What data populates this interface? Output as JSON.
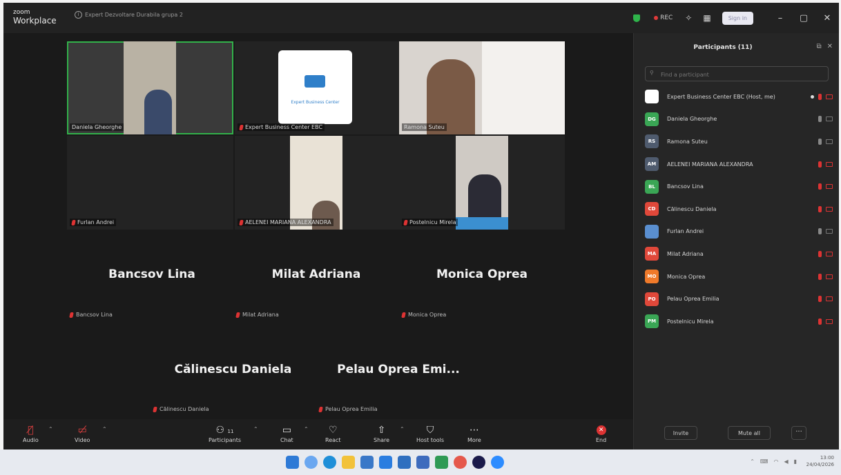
{
  "app": {
    "logo_top": "zoom",
    "logo_bottom": "Workplace",
    "meeting_title": "Expert Dezvoltare Durabila grupa 2"
  },
  "titlebar": {
    "rec_label": "REC",
    "signin_label": "Sign in",
    "minimize": "–",
    "restore": "▢",
    "close": "✕"
  },
  "gallery": {
    "tiles": [
      {
        "name": "Daniela Gheorghe",
        "active": true
      },
      {
        "name": "Expert Business Center EBC",
        "logo_text": "Expert Business Center"
      },
      {
        "name": "Ramona Suteu"
      },
      {
        "name": "Furlan Andrei"
      },
      {
        "name": "AELENEI MARIANA ALEXANDRA"
      },
      {
        "name": "Postelnicu Mirela"
      }
    ],
    "no_video": [
      {
        "big": "Bancsov  Lina",
        "small": "Bancsov Lina"
      },
      {
        "big": "Milat Adriana",
        "small": "Milat Adriana"
      },
      {
        "big": "Monica Oprea",
        "small": "Monica Oprea"
      },
      {
        "big": "Călinescu Daniela",
        "small": "Călinescu Daniela"
      },
      {
        "big": "Pelau  Oprea  Emi...",
        "small": "Pelau Oprea Emilia"
      }
    ]
  },
  "panel": {
    "title": "Participants (11)",
    "search_placeholder": "Find a participant",
    "participants": [
      {
        "initials": "",
        "name": "Expert Business Center EBC (Host, me)",
        "color": "#ffffff",
        "mic": "muted"
      },
      {
        "initials": "DG",
        "name": "Daniela Gheorghe",
        "color": "#3aa655",
        "mic": "on"
      },
      {
        "initials": "RS",
        "name": "Ramona Suteu",
        "color": "#4f5b6e",
        "mic": "on"
      },
      {
        "initials": "AM",
        "name": "AELENEI MARIANA ALEXANDRA",
        "color": "#4f5b6e",
        "mic": "muted"
      },
      {
        "initials": "BL",
        "name": "Bancsov Lina",
        "color": "#3aa655",
        "mic": "muted"
      },
      {
        "initials": "CD",
        "name": "Călinescu Daniela",
        "color": "#e0483a",
        "mic": "muted"
      },
      {
        "initials": "",
        "name": "Furlan Andrei",
        "color": "#5a8fd0",
        "mic": "on"
      },
      {
        "initials": "MA",
        "name": "Milat Adriana",
        "color": "#e0483a",
        "mic": "muted"
      },
      {
        "initials": "MO",
        "name": "Monica Oprea",
        "color": "#f07a2a",
        "mic": "muted"
      },
      {
        "initials": "PO",
        "name": "Pelau Oprea Emilia",
        "color": "#e0483a",
        "mic": "muted"
      },
      {
        "initials": "PM",
        "name": "Postelnicu Mirela",
        "color": "#3aa655",
        "mic": "muted"
      }
    ],
    "invite_label": "Invite",
    "mute_all_label": "Mute all",
    "more_label": "···"
  },
  "toolbar": {
    "audio": "Audio",
    "video": "Video",
    "participants": "Participants",
    "participants_count": "11",
    "chat": "Chat",
    "react": "React",
    "share": "Share",
    "host_tools": "Host tools",
    "more": "More",
    "end": "End"
  },
  "taskbar": {
    "time": "13:00",
    "date": "24/04/2026"
  },
  "colors": {
    "accent_green": "#32b24a",
    "end_red": "#dd3333"
  }
}
